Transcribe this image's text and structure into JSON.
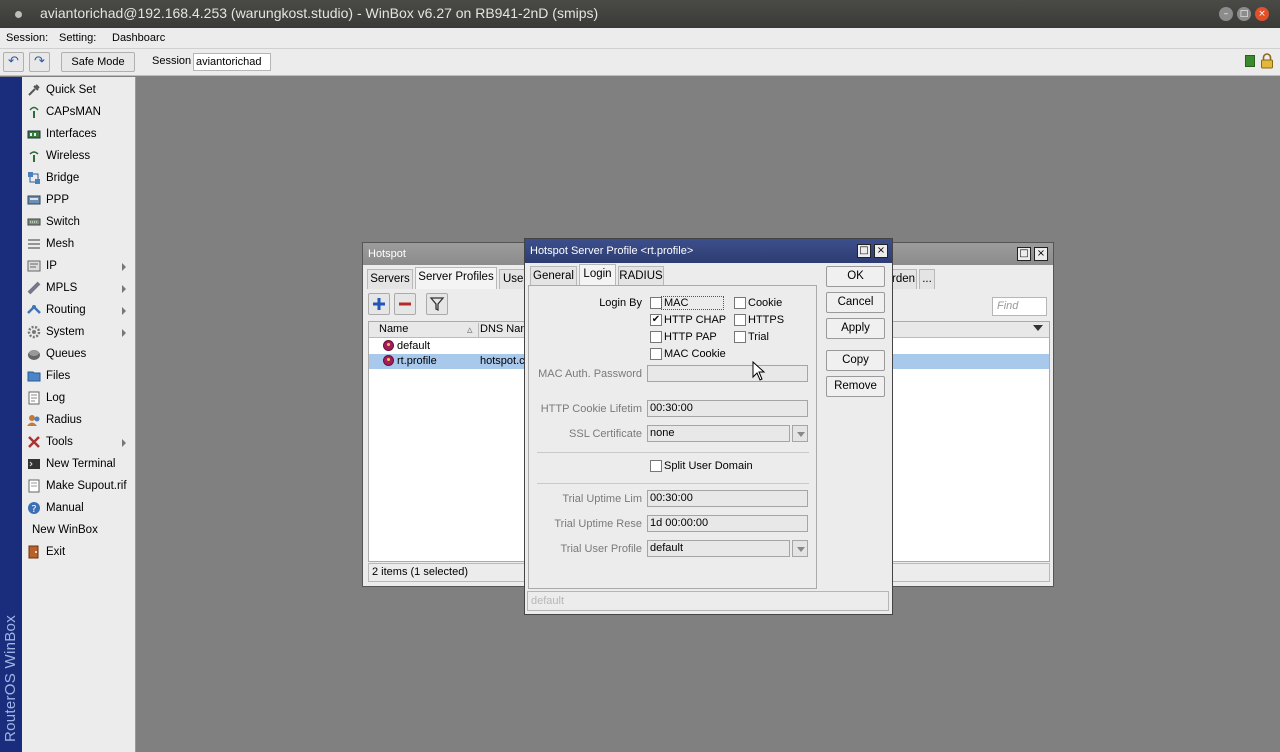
{
  "window": {
    "title": "aviantorichad@192.168.4.253 (warungkost.studio) - WinBox v6.27 on RB941-2nD (smips)"
  },
  "menubar": {
    "session": "Session:",
    "settings": "Setting:",
    "dashboard": "Dashboarc"
  },
  "toolbar": {
    "safe_mode": "Safe Mode",
    "session_label": "Session",
    "session_value": "aviantorichad",
    "accent": "#2c5aa0"
  },
  "branding": {
    "vertical": "RouterOS WinBox"
  },
  "sidebar": {
    "items": [
      {
        "label": "Quick Set",
        "icon": "quick-set-icon",
        "submenu": false
      },
      {
        "label": "CAPsMAN",
        "icon": "capsman-icon",
        "submenu": false
      },
      {
        "label": "Interfaces",
        "icon": "interfaces-icon",
        "submenu": false
      },
      {
        "label": "Wireless",
        "icon": "wireless-icon",
        "submenu": false
      },
      {
        "label": "Bridge",
        "icon": "bridge-icon",
        "submenu": false
      },
      {
        "label": "PPP",
        "icon": "ppp-icon",
        "submenu": false
      },
      {
        "label": "Switch",
        "icon": "switch-icon",
        "submenu": false
      },
      {
        "label": "Mesh",
        "icon": "mesh-icon",
        "submenu": false
      },
      {
        "label": "IP",
        "icon": "ip-icon",
        "submenu": true
      },
      {
        "label": "MPLS",
        "icon": "mpls-icon",
        "submenu": true
      },
      {
        "label": "Routing",
        "icon": "routing-icon",
        "submenu": true
      },
      {
        "label": "System",
        "icon": "system-icon",
        "submenu": true
      },
      {
        "label": "Queues",
        "icon": "queues-icon",
        "submenu": false
      },
      {
        "label": "Files",
        "icon": "files-icon",
        "submenu": false
      },
      {
        "label": "Log",
        "icon": "log-icon",
        "submenu": false
      },
      {
        "label": "Radius",
        "icon": "radius-icon",
        "submenu": false
      },
      {
        "label": "Tools",
        "icon": "tools-icon",
        "submenu": true
      },
      {
        "label": "New Terminal",
        "icon": "terminal-icon",
        "submenu": false
      },
      {
        "label": "Make Supout.rif",
        "icon": "supout-icon",
        "submenu": false
      },
      {
        "label": "Manual",
        "icon": "manual-icon",
        "submenu": false
      },
      {
        "label": "New WinBox",
        "icon": "",
        "submenu": false
      },
      {
        "label": "Exit",
        "icon": "exit-icon",
        "submenu": false
      }
    ]
  },
  "hotspot": {
    "title": "Hotspot",
    "tabs": [
      "Servers",
      "Server Profiles",
      "User"
    ],
    "tab_right": "rden",
    "tab_more": "...",
    "find_placeholder": "Find",
    "columns": [
      "Name",
      "DNS Nam"
    ],
    "rows": [
      {
        "name": "default",
        "dns": ""
      },
      {
        "name": "rt.profile",
        "dns": "hotspot.c"
      }
    ],
    "status": "2 items (1 selected)"
  },
  "profile": {
    "title": "Hotspot Server Profile <rt.profile>",
    "tabs": [
      "General",
      "Login",
      "RADIUS"
    ],
    "login_by_label": "Login By",
    "checks": {
      "mac": {
        "label": "MAC",
        "checked": false
      },
      "cookie": {
        "label": "Cookie",
        "checked": false
      },
      "http_chap": {
        "label": "HTTP CHAP",
        "checked": true
      },
      "https": {
        "label": "HTTPS",
        "checked": false
      },
      "http_pap": {
        "label": "HTTP PAP",
        "checked": false
      },
      "trial": {
        "label": "Trial",
        "checked": false
      },
      "mac_cookie": {
        "label": "MAC Cookie",
        "checked": false
      }
    },
    "mac_auth_label": "MAC Auth. Password",
    "mac_auth_value": "",
    "cookie_lifetime_label": "HTTP Cookie Lifetim",
    "cookie_lifetime_value": "00:30:00",
    "ssl_label": "SSL Certificate",
    "ssl_value": "none",
    "split_label": "Split User Domain",
    "trial_uptime_label": "Trial Uptime Lim",
    "trial_uptime_value": "00:30:00",
    "trial_reset_label": "Trial Uptime Rese",
    "trial_reset_value": "1d 00:00:00",
    "trial_profile_label": "Trial User Profile",
    "trial_profile_value": "default",
    "buttons": {
      "ok": "OK",
      "cancel": "Cancel",
      "apply": "Apply",
      "copy": "Copy",
      "remove": "Remove"
    },
    "status": "default"
  }
}
